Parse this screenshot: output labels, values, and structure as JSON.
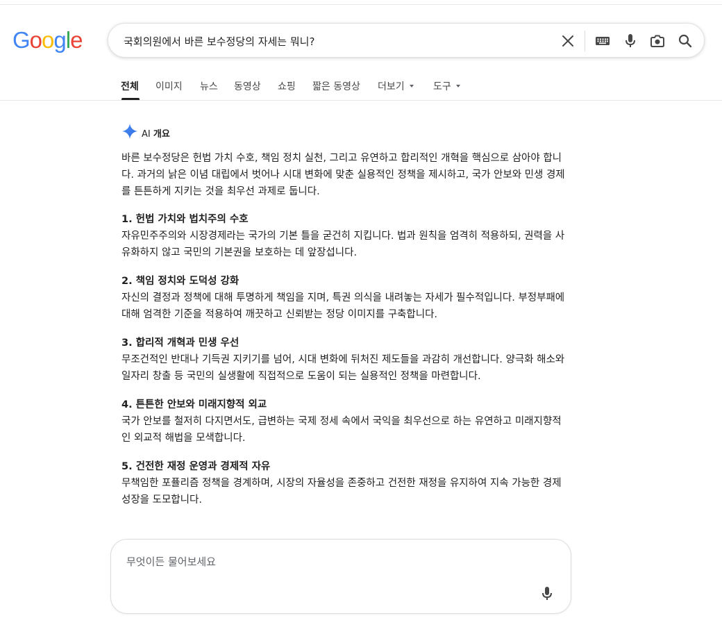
{
  "logo": {
    "letters": [
      "G",
      "o",
      "o",
      "g",
      "l",
      "e"
    ],
    "colors": [
      "#4285F4",
      "#EA4335",
      "#FBBC05",
      "#4285F4",
      "#34A853",
      "#EA4335"
    ]
  },
  "search": {
    "query": "국회의원에서 바른 보수정당의 자세는 뭐니?",
    "icons": [
      "close-icon",
      "keyboard-icon",
      "mic-icon",
      "lens-icon",
      "search-icon"
    ]
  },
  "tabs": [
    {
      "label": "전체",
      "active": true
    },
    {
      "label": "이미지"
    },
    {
      "label": "뉴스"
    },
    {
      "label": "동영상"
    },
    {
      "label": "쇼핑"
    },
    {
      "label": "짧은 동영상"
    },
    {
      "label": "더보기"
    },
    {
      "label": "도구"
    }
  ],
  "ai_overview": {
    "label_prefix": "AI",
    "label": "개요",
    "intro": "바른 보수정당은 헌법 가치 수호, 책임 정치 실천, 그리고 유연하고 합리적인 개혁을 핵심으로 삼아야 합니다. 과거의 낡은 이념 대립에서 벗어나 시대 변화에 맞춘 실용적인 정책을 제시하고, 국가 안보와 민생 경제를 튼튼하게 지키는 것을 최우선 과제로 둡니다.",
    "sections": [
      {
        "title": "1. 헌법 가치와 법치주의 수호",
        "body": "자유민주주의와 시장경제라는 국가의 기본 틀을 굳건히 지킵니다. 법과 원칙을 엄격히 적용하되, 권력을 사유화하지 않고 국민의 기본권을 보호하는 데 앞장섭니다."
      },
      {
        "title": "2. 책임 정치와 도덕성 강화",
        "body": "자신의 결정과 정책에 대해 투명하게 책임을 지며, 특권 의식을 내려놓는 자세가 필수적입니다. 부정부패에 대해 엄격한 기준을 적용하여 깨끗하고 신뢰받는 정당 이미지를 구축합니다."
      },
      {
        "title": "3. 합리적 개혁과 민생 우선",
        "body": "무조건적인 반대나 기득권 지키기를 넘어, 시대 변화에 뒤처진 제도들을 과감히 개선합니다. 양극화 해소와 일자리 창출 등 국민의 실생활에 직접적으로 도움이 되는 실용적인 정책을 마련합니다."
      },
      {
        "title": "4. 튼튼한 안보와 미래지향적 외교",
        "body": "국가 안보를 철저히 다지면서도, 급변하는 국제 정세 속에서 국익을 최우선으로 하는 유연하고 미래지향적인 외교적 해법을 모색합니다."
      },
      {
        "title": "5. 건전한 재정 운영과 경제적 자유",
        "body": "무책임한 포퓰리즘 정책을 경계하며, 시장의 자율성을 존중하고 건전한 재정을 유지하여 지속 가능한 경제 성장을 도모합니다."
      }
    ]
  },
  "ask": {
    "placeholder": "무엇이든 물어보세요"
  }
}
